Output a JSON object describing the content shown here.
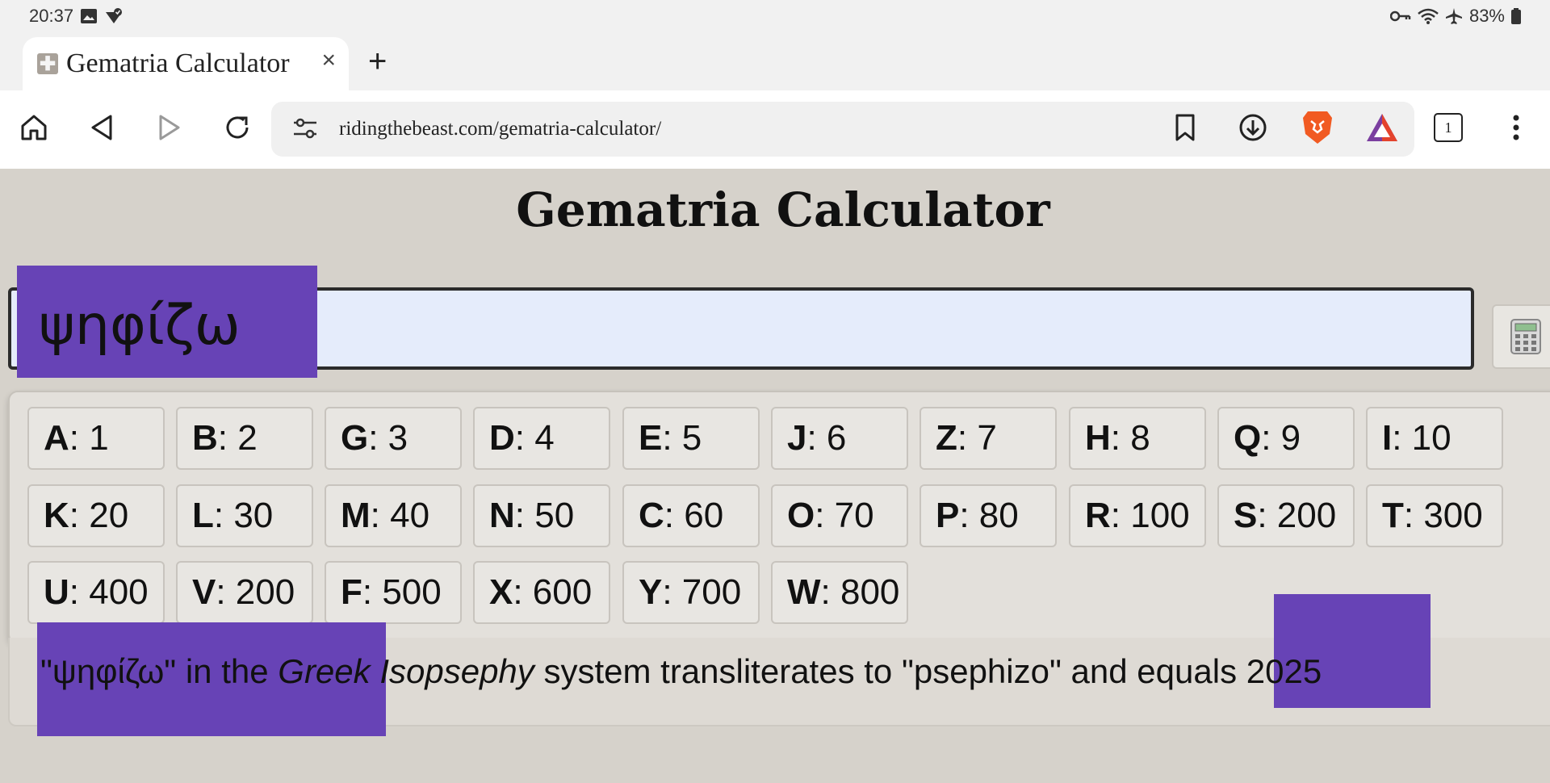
{
  "status_bar": {
    "time": "20:37",
    "battery": "83%"
  },
  "browser": {
    "tab_title": "Gematria Calculator",
    "new_tab": "+",
    "close_tab": "×",
    "url": "ridingthebeast.com/gematria-calculator/",
    "tab_count": "1"
  },
  "page": {
    "heading": "Gematria Calculator",
    "input_value": "ψηφίζω",
    "keys": [
      {
        "letter": "A",
        "value": ": 1"
      },
      {
        "letter": "B",
        "value": ": 2"
      },
      {
        "letter": "G",
        "value": ": 3"
      },
      {
        "letter": "D",
        "value": ": 4"
      },
      {
        "letter": "E",
        "value": ": 5"
      },
      {
        "letter": "J",
        "value": ": 6"
      },
      {
        "letter": "Z",
        "value": ": 7"
      },
      {
        "letter": "H",
        "value": ": 8"
      },
      {
        "letter": "Q",
        "value": ": 9"
      },
      {
        "letter": "I",
        "value": ": 10"
      },
      {
        "letter": "K",
        "value": ": 20"
      },
      {
        "letter": "L",
        "value": ": 30"
      },
      {
        "letter": "M",
        "value": ": 40"
      },
      {
        "letter": "N",
        "value": ": 50"
      },
      {
        "letter": "C",
        "value": ": 60"
      },
      {
        "letter": "O",
        "value": ": 70"
      },
      {
        "letter": "P",
        "value": ": 80"
      },
      {
        "letter": "R",
        "value": ": 100"
      },
      {
        "letter": "S",
        "value": ": 200"
      },
      {
        "letter": "T",
        "value": ": 300"
      },
      {
        "letter": "U",
        "value": ": 400"
      },
      {
        "letter": "V",
        "value": ": 200"
      },
      {
        "letter": "F",
        "value": ": 500"
      },
      {
        "letter": "X",
        "value": ": 600"
      },
      {
        "letter": "Y",
        "value": ": 700"
      },
      {
        "letter": "W",
        "value": ": 800"
      }
    ],
    "result": {
      "part1": "\"ψηφίζω\" in the ",
      "system_word1": "Greek",
      "system_word2": "Isopsephy",
      "part2": " system transliterates to \"psephizo\" and equals ",
      "total": "2025"
    }
  },
  "colors": {
    "highlight": "#6743b6",
    "input_bg": "#e5ecfb",
    "page_bg": "#d6d2cb"
  }
}
